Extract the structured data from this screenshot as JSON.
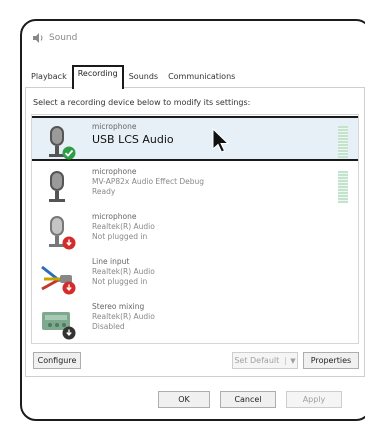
{
  "window": {
    "title": "Sound"
  },
  "tabs": [
    {
      "label": "Playback"
    },
    {
      "label": "Recording",
      "active": true
    },
    {
      "label": "Sounds"
    },
    {
      "label": "Communications"
    }
  ],
  "instruction": "Select a recording device below to modify its settings:",
  "devices": [
    {
      "name": "microphone",
      "description": "USB LCS Audio",
      "status": "",
      "icon": "microphone-icon",
      "badge": "default-check"
    },
    {
      "name": "microphone",
      "description": "MV-AP82x Audio Effect Debug",
      "status": "Ready",
      "icon": "microphone-icon",
      "badge": ""
    },
    {
      "name": "microphone",
      "description": "Realtek(R) Audio",
      "status": "Not plugged in",
      "icon": "microphone-icon",
      "badge": "unplugged"
    },
    {
      "name": "Line input",
      "description": "Realtek(R) Audio",
      "status": "Not plugged in",
      "icon": "line-input-icon",
      "badge": "unplugged"
    },
    {
      "name": "Stereo mixing",
      "description": "Realtek(R) Audio",
      "status": "Disabled",
      "icon": "stereo-mix-icon",
      "badge": "disabled"
    }
  ],
  "buttons": {
    "configure": "Configure",
    "set_default": "Set Default",
    "properties": "Properties",
    "ok": "OK",
    "cancel": "Cancel",
    "apply": "Apply"
  },
  "colors": {
    "selection_border": "#1a1a1a",
    "selection_bg": "#e8f0f7",
    "default_badge": "#2e9e46",
    "unplugged_badge": "#d42b2b",
    "meter": "#c4e3cf"
  }
}
